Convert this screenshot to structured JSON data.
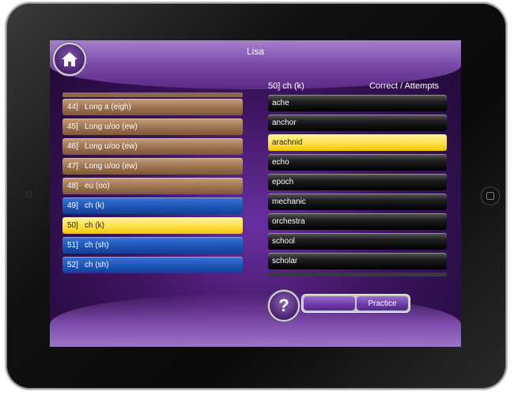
{
  "header": {
    "user_name": "Lisa"
  },
  "sound_list": [
    {
      "number": "44]",
      "label": "Long a (eigh)",
      "style": "brown"
    },
    {
      "number": "45]",
      "label": "Long u/oo (ew)",
      "style": "brown"
    },
    {
      "number": "46]",
      "label": "Long u/oo (ew)",
      "style": "brown"
    },
    {
      "number": "47]",
      "label": "Long u/oo (ew)",
      "style": "brown"
    },
    {
      "number": "48]",
      "label": "eu (oo)",
      "style": "brown"
    },
    {
      "number": "49]",
      "label": "ch (k)",
      "style": "blue"
    },
    {
      "number": "50]",
      "label": "ch (k)",
      "style": "yellow"
    },
    {
      "number": "51]",
      "label": "ch (sh)",
      "style": "blue"
    },
    {
      "number": "52]",
      "label": "ch (sh)",
      "style": "blue"
    }
  ],
  "word_panel": {
    "current_sound": "50]   ch (k)",
    "score_header": "Correct / Attempts",
    "words": [
      {
        "word": "ache",
        "style": "black"
      },
      {
        "word": "anchor",
        "style": "black"
      },
      {
        "word": "arachnid",
        "style": "yellow"
      },
      {
        "word": "echo",
        "style": "black"
      },
      {
        "word": "epoch",
        "style": "black"
      },
      {
        "word": "mechanic",
        "style": "black"
      },
      {
        "word": "orchestra",
        "style": "black"
      },
      {
        "word": "school",
        "style": "black"
      },
      {
        "word": "scholar",
        "style": "black"
      }
    ]
  },
  "controls": {
    "help_icon": "question-mark-icon",
    "home_icon": "house-icon",
    "mode_left_label": "",
    "mode_right_label": "Practice"
  },
  "colors": {
    "brown_item": "#9b7251",
    "blue_item": "#1e55b8",
    "highlight_yellow": "#ffe04a",
    "word_black": "#000000",
    "background_purple": "#3d1560"
  }
}
